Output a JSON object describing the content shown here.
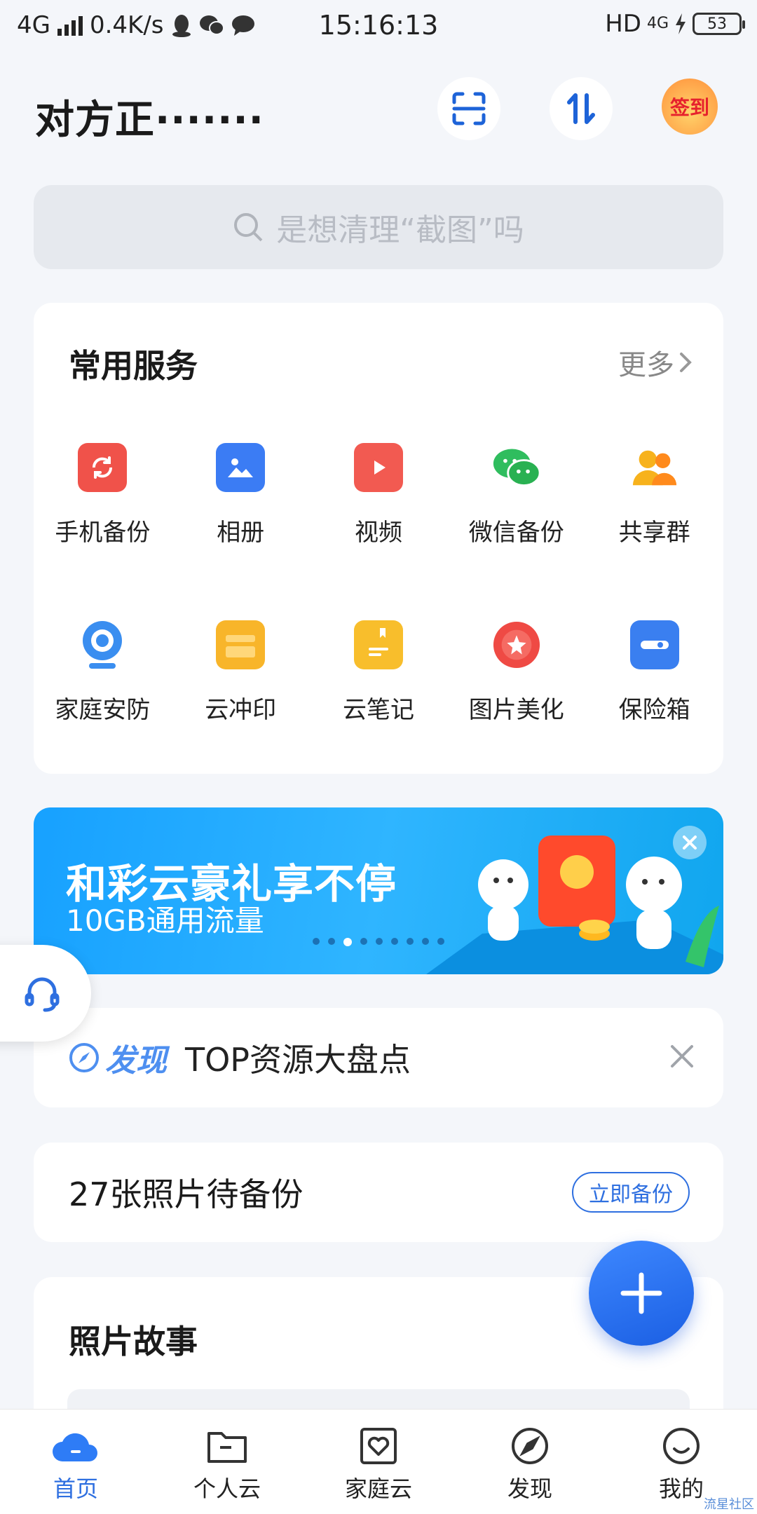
{
  "status_bar": {
    "network": "4G",
    "speed": "0.4K/s",
    "time": "15:16:13",
    "hd": "HD",
    "net_right": "4G",
    "battery": "53"
  },
  "header": {
    "title": "对方正·······",
    "scan_icon": "scan-icon",
    "transfer_icon": "transfer-icon",
    "checkin_label": "签到"
  },
  "search": {
    "placeholder": "是想清理“截图”吗"
  },
  "services": {
    "title": "常用服务",
    "more": "更多",
    "items": [
      {
        "label": "手机备份",
        "icon": "phone-backup-icon",
        "color": "#f0524a"
      },
      {
        "label": "相册",
        "icon": "album-icon",
        "color": "#3b7cf4"
      },
      {
        "label": "视频",
        "icon": "video-icon",
        "color": "#f25a51"
      },
      {
        "label": "微信备份",
        "icon": "wechat-icon",
        "color": "#2fbd5e"
      },
      {
        "label": "共享群",
        "icon": "share-group-icon",
        "color": "#f7b21c"
      },
      {
        "label": "家庭安防",
        "icon": "camera-icon",
        "color": "#3a8ef0"
      },
      {
        "label": "云冲印",
        "icon": "print-icon",
        "color": "#f8b52a"
      },
      {
        "label": "云笔记",
        "icon": "note-icon",
        "color": "#f8be2c"
      },
      {
        "label": "图片美化",
        "icon": "beautify-icon",
        "color": "#ef4a44"
      },
      {
        "label": "保险箱",
        "icon": "safe-icon",
        "color": "#3a7ff0"
      }
    ]
  },
  "banner": {
    "title": "和彩云豪礼享不停",
    "subtitle": "10GB通用流量",
    "dots": 9,
    "active_dot": 2
  },
  "discover": {
    "tag": "发现",
    "text": "TOP资源大盘点"
  },
  "backup": {
    "text": "27张照片待备份",
    "button": "立即备份"
  },
  "story": {
    "title": "照片故事"
  },
  "nav": {
    "items": [
      {
        "label": "首页",
        "icon": "home-cloud-icon",
        "active": true
      },
      {
        "label": "个人云",
        "icon": "folder-icon",
        "active": false
      },
      {
        "label": "家庭云",
        "icon": "family-heart-icon",
        "active": false
      },
      {
        "label": "发现",
        "icon": "compass-icon",
        "active": false
      },
      {
        "label": "我的",
        "icon": "smile-icon",
        "active": false
      }
    ]
  },
  "watermark": "流星社区",
  "colors": {
    "accent": "#2e6fe0",
    "background": "#f4f6fa"
  }
}
